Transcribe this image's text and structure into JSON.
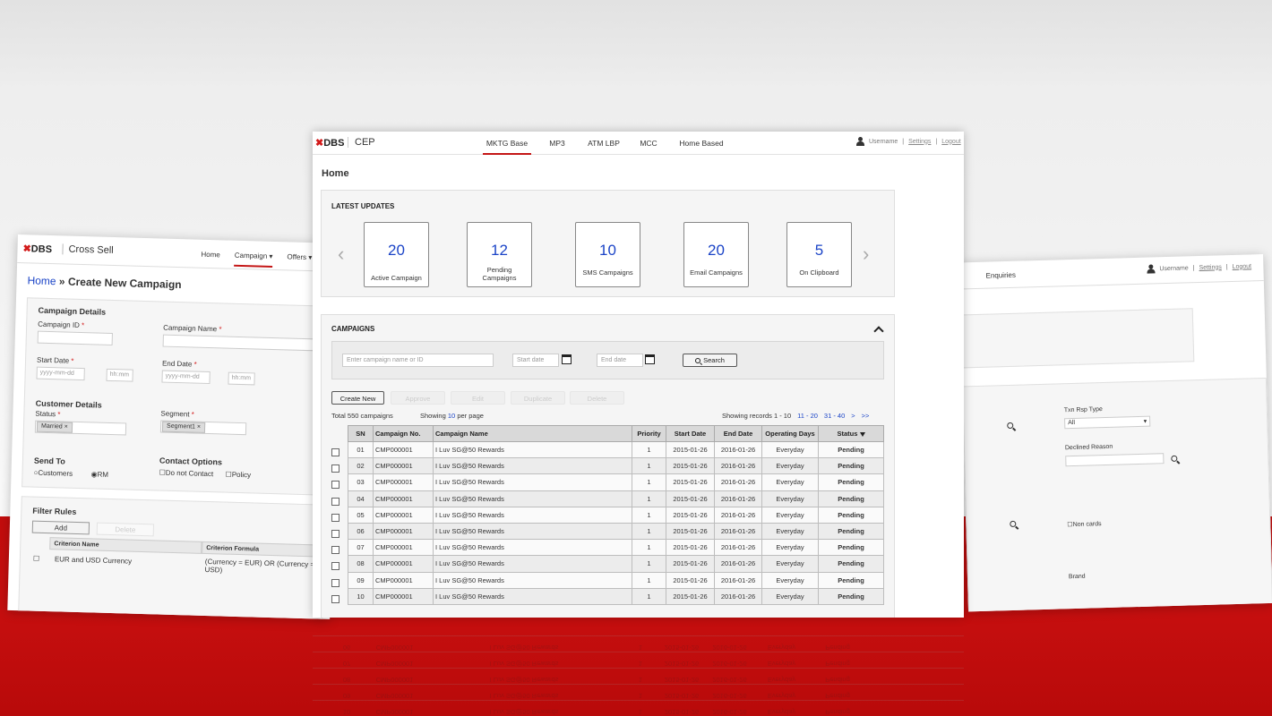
{
  "left_window": {
    "logo": "DBS",
    "app_name": "Cross Sell",
    "nav": [
      "Home",
      "Campaign ▾",
      "Offers ▾"
    ],
    "breadcrumb_home": "Home",
    "breadcrumb_sep": "»",
    "page_title": "Create New Campaign",
    "campaign_details": "Campaign Details",
    "campaign_id_label": "Campaign ID",
    "campaign_name_label": "Campaign  Name",
    "start_date_label": "Start Date",
    "end_date_label": "End Date",
    "date_placeholder": "yyyy-mm-dd",
    "time_placeholder": "hh:mm",
    "customer_details": "Customer Details",
    "status_label": "Status",
    "status_value": "Married",
    "segment_label": "Segment",
    "segment_value": "Segment1",
    "send_to": "Send To",
    "send_customers": "Customers",
    "send_rm": "RM",
    "contact_options": "Contact Options",
    "do_not_contact": "Do not Contact",
    "policy": "Policy",
    "filter_rules": "Filter Rules",
    "add": "Add",
    "delete": "Delete",
    "criterion_name": "Criterion Name",
    "criterion_formula": "Criterion Formula",
    "rule_name": "EUR and USD Currency",
    "rule_formula": "(Currency = EUR) OR (Currency = USD)"
  },
  "right_window": {
    "nav_enquiries": "Enquiries",
    "username": "Username",
    "settings": "Settings",
    "logout": "Logout",
    "txn_rsp_type": "Txn Rsp Type",
    "txn_value": "All",
    "declined_reason": "Declined Reason",
    "non_cards": "Non cards",
    "brand": "Brand"
  },
  "main": {
    "logo": "DBS",
    "app_name": "CEP",
    "tabs": [
      "MKTG Base",
      "MP3",
      "ATM LBP",
      "MCC",
      "Home Based"
    ],
    "username": "Username",
    "settings": "Settings",
    "logout": "Logout",
    "page_title": "Home",
    "latest_updates": "LATEST UPDATES",
    "cards": [
      {
        "value": "20",
        "label": "Active Campaign"
      },
      {
        "value": "12",
        "label": "Pending Campaigns"
      },
      {
        "value": "10",
        "label": "SMS Campaigns"
      },
      {
        "value": "20",
        "label": "Email Campaigns"
      },
      {
        "value": "5",
        "label": "On Clipboard"
      }
    ],
    "campaigns_title": "CAMPAIGNS",
    "search_placeholder": "Enter campaign name or ID",
    "start_date_placeholder": "Start date",
    "end_date_placeholder": "End date",
    "search_button": "Search",
    "actions": [
      "Create New",
      "Approve",
      "Edit",
      "Duplicate",
      "Delete"
    ],
    "total": "Total 550 campaigns",
    "showing_prefix": "Showing",
    "per_page": "10",
    "showing_suffix": "per page",
    "records": "Showing records 1 - 10",
    "pages": [
      "11 - 20",
      "31 - 40",
      ">",
      ">>"
    ],
    "columns": [
      "SN",
      "Campaign No.",
      "Campaign Name",
      "Priority",
      "Start Date",
      "End Date",
      "Operating Days",
      "Status"
    ],
    "rows": [
      [
        "01",
        "CMP000001",
        "I Luv SG@50 Rewards",
        "1",
        "2015-01-26",
        "2016-01-26",
        "Everyday",
        "Pending"
      ],
      [
        "02",
        "CMP000001",
        "I Luv SG@50 Rewards",
        "1",
        "2015-01-26",
        "2016-01-26",
        "Everyday",
        "Pending"
      ],
      [
        "03",
        "CMP000001",
        "I Luv SG@50 Rewards",
        "1",
        "2015-01-26",
        "2016-01-26",
        "Everyday",
        "Pending"
      ],
      [
        "04",
        "CMP000001",
        "I Luv SG@50 Rewards",
        "1",
        "2015-01-26",
        "2016-01-26",
        "Everyday",
        "Pending"
      ],
      [
        "05",
        "CMP000001",
        "I Luv SG@50 Rewards",
        "1",
        "2015-01-26",
        "2016-01-26",
        "Everyday",
        "Pending"
      ],
      [
        "06",
        "CMP000001",
        "I Luv SG@50 Rewards",
        "1",
        "2015-01-26",
        "2016-01-26",
        "Everyday",
        "Pending"
      ],
      [
        "07",
        "CMP000001",
        "I Luv SG@50 Rewards",
        "1",
        "2015-01-26",
        "2016-01-26",
        "Everyday",
        "Pending"
      ],
      [
        "08",
        "CMP000001",
        "I Luv SG@50 Rewards",
        "1",
        "2015-01-26",
        "2016-01-26",
        "Everyday",
        "Pending"
      ],
      [
        "09",
        "CMP000001",
        "I Luv SG@50 Rewards",
        "1",
        "2015-01-26",
        "2016-01-26",
        "Everyday",
        "Pending"
      ],
      [
        "10",
        "CMP000001",
        "I Luv SG@50 Rewards",
        "1",
        "2015-01-26",
        "2016-01-26",
        "Everyday",
        "Pending"
      ]
    ]
  },
  "colors": {
    "brand_red": "#c41616",
    "link_blue": "#1b44c7",
    "band_red": "#c30d0d"
  }
}
